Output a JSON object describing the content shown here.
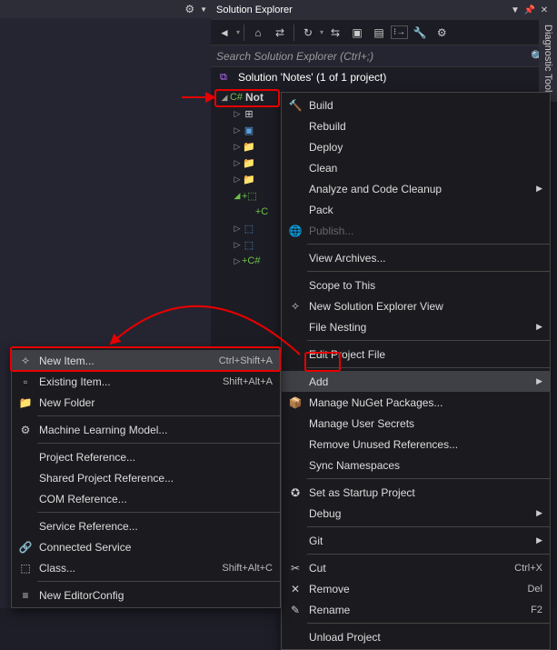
{
  "header": {
    "title": "Solution Explorer"
  },
  "search": {
    "placeholder": "Search Solution Explorer (Ctrl+;)"
  },
  "solution": {
    "label": "Solution 'Notes' (1 of 1 project)"
  },
  "project": {
    "name": "Not"
  },
  "side_tab": "Diagnostic Tools",
  "context_main": [
    {
      "icon": "hammer",
      "label": "Build"
    },
    {
      "icon": "",
      "label": "Rebuild"
    },
    {
      "icon": "",
      "label": "Deploy"
    },
    {
      "icon": "",
      "label": "Clean"
    },
    {
      "icon": "",
      "label": "Analyze and Code Cleanup",
      "submenu": true
    },
    {
      "icon": "",
      "label": "Pack"
    },
    {
      "icon": "globe",
      "label": "Publish...",
      "disabled": true
    },
    {
      "sep": true
    },
    {
      "icon": "",
      "label": "View Archives..."
    },
    {
      "sep": true
    },
    {
      "icon": "",
      "label": "Scope to This"
    },
    {
      "icon": "newview",
      "label": "New Solution Explorer View"
    },
    {
      "icon": "",
      "label": "File Nesting",
      "submenu": true
    },
    {
      "sep": true
    },
    {
      "icon": "",
      "label": "Edit Project File"
    },
    {
      "sep": true
    },
    {
      "icon": "",
      "label": "Add",
      "submenu": true,
      "sel": true
    },
    {
      "icon": "nuget",
      "label": "Manage NuGet Packages..."
    },
    {
      "icon": "",
      "label": "Manage User Secrets"
    },
    {
      "icon": "",
      "label": "Remove Unused References..."
    },
    {
      "icon": "",
      "label": "Sync Namespaces"
    },
    {
      "sep": true
    },
    {
      "icon": "star",
      "label": "Set as Startup Project"
    },
    {
      "icon": "",
      "label": "Debug",
      "submenu": true
    },
    {
      "sep": true
    },
    {
      "icon": "",
      "label": "Git",
      "submenu": true
    },
    {
      "sep": true
    },
    {
      "icon": "cut",
      "label": "Cut",
      "shortcut": "Ctrl+X"
    },
    {
      "icon": "remove",
      "label": "Remove",
      "shortcut": "Del"
    },
    {
      "icon": "rename",
      "label": "Rename",
      "shortcut": "F2"
    },
    {
      "sep": true
    },
    {
      "icon": "",
      "label": "Unload Project"
    }
  ],
  "context_sub": [
    {
      "icon": "newitem",
      "label": "New Item...",
      "shortcut": "Ctrl+Shift+A",
      "sel": true
    },
    {
      "icon": "existing",
      "label": "Existing Item...",
      "shortcut": "Shift+Alt+A"
    },
    {
      "icon": "folder",
      "label": "New Folder"
    },
    {
      "sep": true
    },
    {
      "icon": "ml",
      "label": "Machine Learning Model..."
    },
    {
      "sep": true
    },
    {
      "icon": "",
      "label": "Project Reference..."
    },
    {
      "icon": "",
      "label": "Shared Project Reference..."
    },
    {
      "icon": "",
      "label": "COM Reference..."
    },
    {
      "sep": true
    },
    {
      "icon": "",
      "label": "Service Reference..."
    },
    {
      "icon": "connected",
      "label": "Connected Service"
    },
    {
      "icon": "class",
      "label": "Class...",
      "shortcut": "Shift+Alt+C"
    },
    {
      "sep": true
    },
    {
      "icon": "editorconfig",
      "label": "New EditorConfig"
    }
  ]
}
